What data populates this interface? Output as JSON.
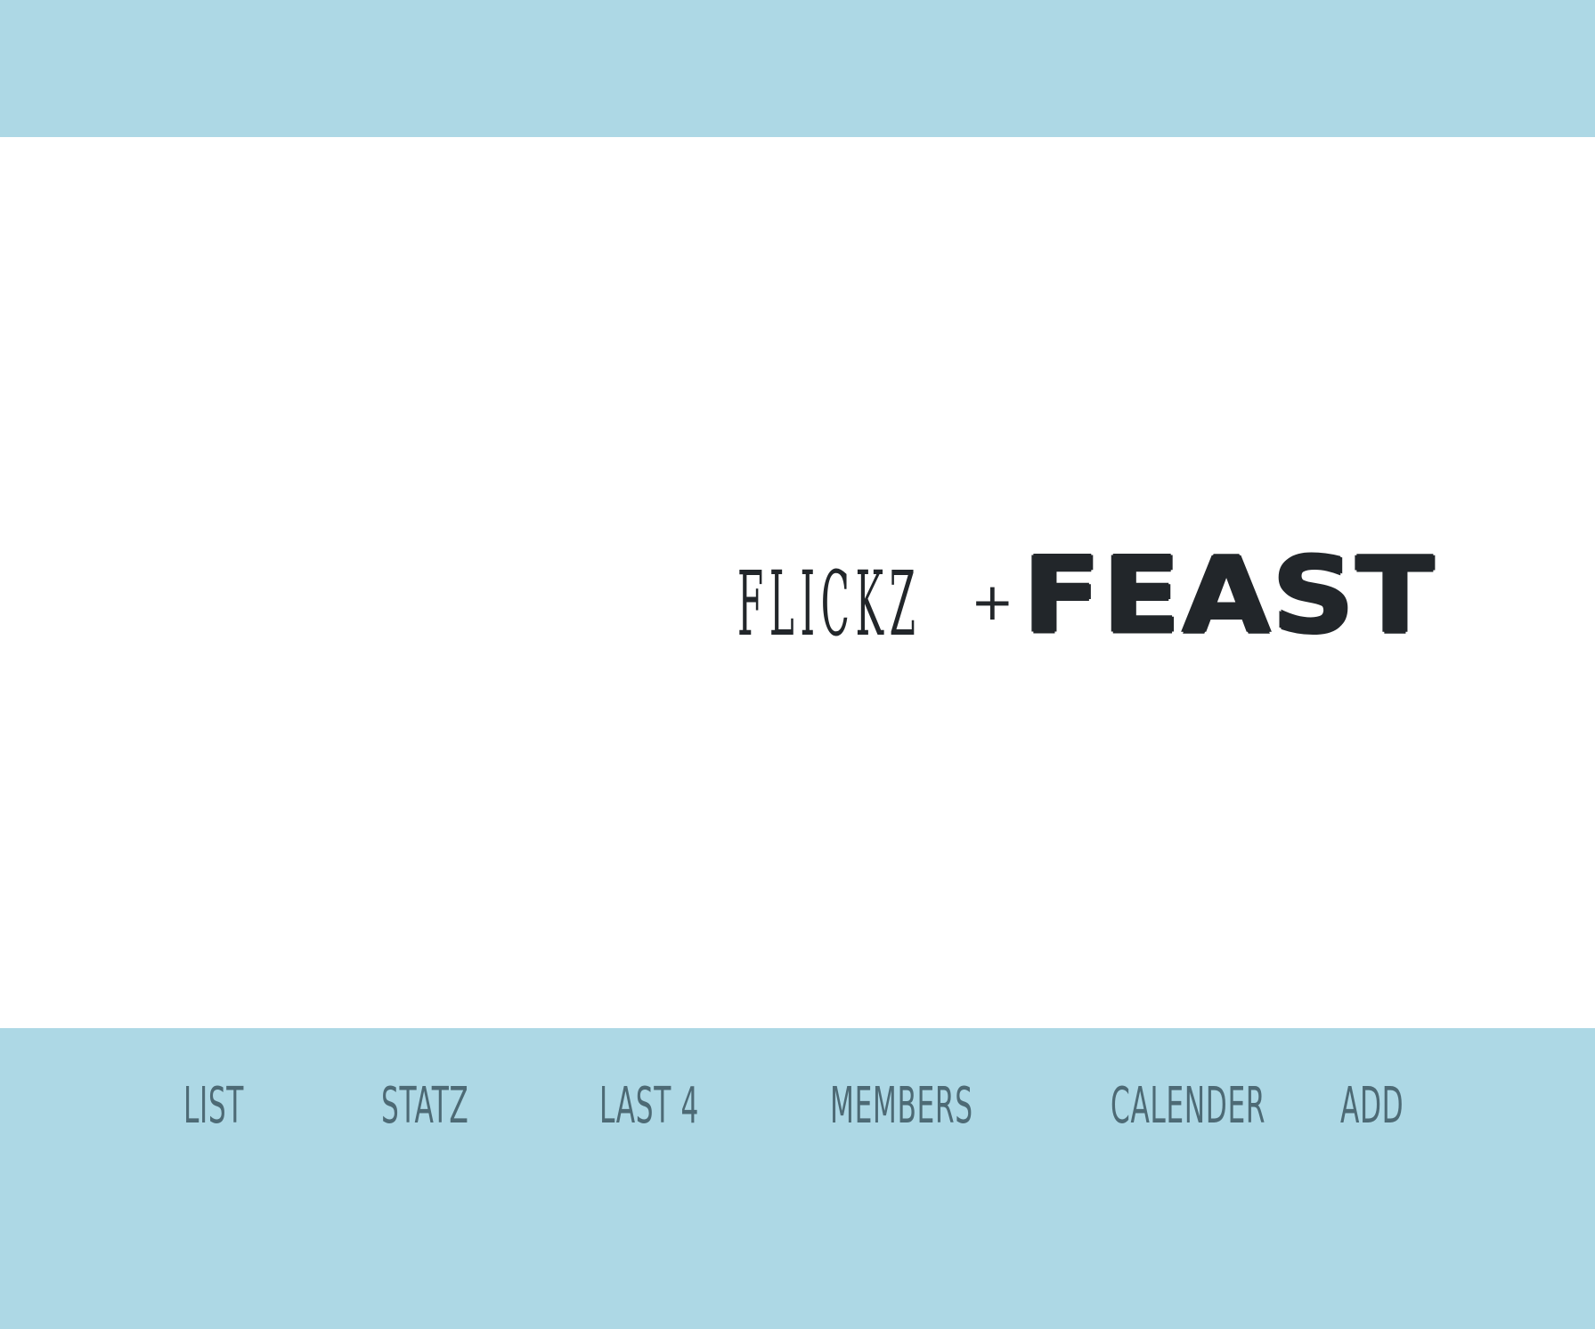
{
  "logo": {
    "part1": "FLICKZ",
    "plus": "+",
    "part2": "FEAST"
  },
  "nav": {
    "items": [
      {
        "label": "LIST"
      },
      {
        "label": "STATZ"
      },
      {
        "label": "LAST 4"
      },
      {
        "label": "MEMBERS"
      },
      {
        "label": "CALENDER"
      },
      {
        "label": "ADD"
      }
    ]
  },
  "colors": {
    "band": "#add8e5",
    "nav_text": "#4d6a75",
    "logo_text": "#22262a",
    "background": "#ffffff"
  }
}
